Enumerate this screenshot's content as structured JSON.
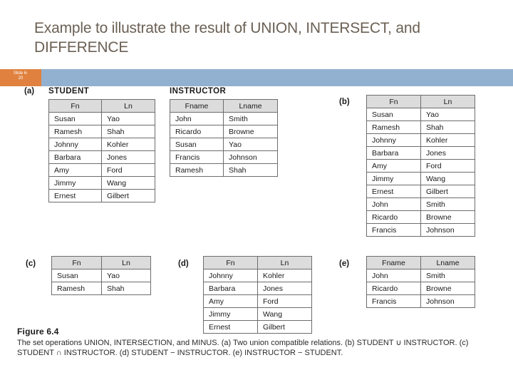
{
  "slide": {
    "title": "Example to illustrate the result of UNION, INTERSECT, and DIFFERENCE",
    "badge_line1": "Slide 6-",
    "badge_line2": "20",
    "band_color": "#92b0cf",
    "badge_color": "#e0813f",
    "title_color": "#6b6054"
  },
  "figure": {
    "number": "Figure 6.4",
    "caption": "The set operations UNION, INTERSECTION, and MINUS. (a) Two union compatible relations. (b) STUDENT ∪ INSTRUCTOR. (c) STUDENT ∩ INSTRUCTOR. (d) STUDENT − INSTRUCTOR. (e) INSTRUCTOR − STUDENT."
  },
  "relations": [
    {
      "part": "(a)",
      "name": "STUDENT",
      "columns": [
        "Fn",
        "Ln"
      ],
      "rows": [
        [
          "Susan",
          "Yao"
        ],
        [
          "Ramesh",
          "Shah"
        ],
        [
          "Johnny",
          "Kohler"
        ],
        [
          "Barbara",
          "Jones"
        ],
        [
          "Amy",
          "Ford"
        ],
        [
          "Jimmy",
          "Wang"
        ],
        [
          "Ernest",
          "Gilbert"
        ]
      ]
    },
    {
      "part": "",
      "name": "INSTRUCTOR",
      "columns": [
        "Fname",
        "Lname"
      ],
      "rows": [
        [
          "John",
          "Smith"
        ],
        [
          "Ricardo",
          "Browne"
        ],
        [
          "Susan",
          "Yao"
        ],
        [
          "Francis",
          "Johnson"
        ],
        [
          "Ramesh",
          "Shah"
        ]
      ]
    },
    {
      "part": "(b)",
      "name": "",
      "columns": [
        "Fn",
        "Ln"
      ],
      "rows": [
        [
          "Susan",
          "Yao"
        ],
        [
          "Ramesh",
          "Shah"
        ],
        [
          "Johnny",
          "Kohler"
        ],
        [
          "Barbara",
          "Jones"
        ],
        [
          "Amy",
          "Ford"
        ],
        [
          "Jimmy",
          "Wang"
        ],
        [
          "Ernest",
          "Gilbert"
        ],
        [
          "John",
          "Smith"
        ],
        [
          "Ricardo",
          "Browne"
        ],
        [
          "Francis",
          "Johnson"
        ]
      ]
    },
    {
      "part": "(c)",
      "name": "",
      "columns": [
        "Fn",
        "Ln"
      ],
      "rows": [
        [
          "Susan",
          "Yao"
        ],
        [
          "Ramesh",
          "Shah"
        ]
      ]
    },
    {
      "part": "(d)",
      "name": "",
      "columns": [
        "Fn",
        "Ln"
      ],
      "rows": [
        [
          "Johnny",
          "Kohler"
        ],
        [
          "Barbara",
          "Jones"
        ],
        [
          "Amy",
          "Ford"
        ],
        [
          "Jimmy",
          "Wang"
        ],
        [
          "Ernest",
          "Gilbert"
        ]
      ]
    },
    {
      "part": "(e)",
      "name": "",
      "columns": [
        "Fname",
        "Lname"
      ],
      "rows": [
        [
          "John",
          "Smith"
        ],
        [
          "Ricardo",
          "Browne"
        ],
        [
          "Francis",
          "Johnson"
        ]
      ]
    }
  ]
}
